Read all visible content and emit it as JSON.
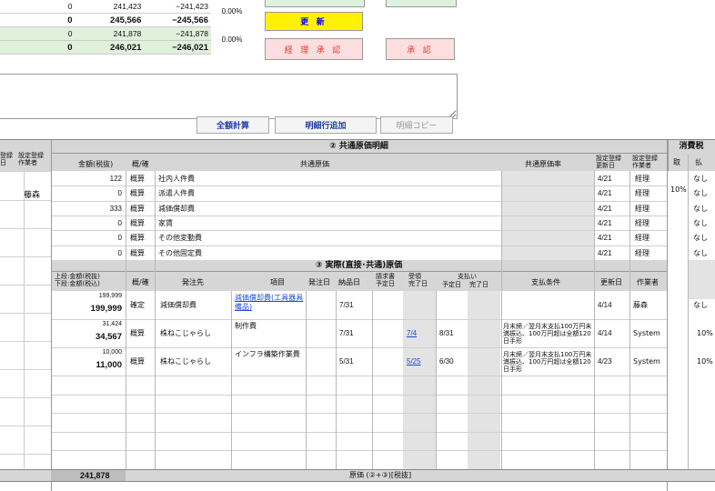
{
  "summary": {
    "rows": [
      {
        "a": "0",
        "b": "241,423",
        "c": "−241,423",
        "style": "plain"
      },
      {
        "a": "0",
        "b": "245,566",
        "c": "−245,566",
        "style": "bold"
      },
      {
        "a": "0",
        "b": "241,878",
        "c": "−241,878",
        "style": "green"
      },
      {
        "a": "0",
        "b": "246,021",
        "c": "−246,021",
        "style": "greenbold"
      }
    ],
    "pct1": "0.00%",
    "pct2": "0.00%"
  },
  "buttons": {
    "update": "更 新",
    "approve_keiri": "経 理 承 認",
    "approve": "承 認",
    "calc_all": "全額計算",
    "add_line": "明細行追加",
    "copy_line": "明細コピー"
  },
  "left_header": {
    "col1": "登録\n日",
    "col2": "設定登録\n作業者"
  },
  "left_row_user": "藤森",
  "shared": {
    "title": "② 共通原価明細",
    "col_amount": "金額(税抜)",
    "col_kind": "概/確",
    "col_name": "共通原価",
    "col_ratio": "共通原価率",
    "col_upd": "設定登録\n更新日",
    "col_user": "設定登録\n作業者",
    "rows": [
      {
        "amount": "122",
        "kind": "概算",
        "name": "社内人件費",
        "date": "4/21",
        "user": "経理"
      },
      {
        "amount": "0",
        "kind": "概算",
        "name": "派遣人件費",
        "date": "4/21",
        "user": "経理"
      },
      {
        "amount": "333",
        "kind": "概算",
        "name": "減価償却費",
        "date": "4/21",
        "user": "経理"
      },
      {
        "amount": "0",
        "kind": "概算",
        "name": "家賃",
        "date": "4/21",
        "user": "経理"
      },
      {
        "amount": "0",
        "kind": "概算",
        "name": "その他変動費",
        "date": "4/21",
        "user": "経理"
      },
      {
        "amount": "0",
        "kind": "概算",
        "name": "その他固定費",
        "date": "4/21",
        "user": "経理"
      }
    ]
  },
  "tax": {
    "title": "消費税",
    "col_take": "取",
    "col_pay": "払",
    "rate": "10%",
    "none": "なし"
  },
  "actual": {
    "title": "③ 実際(直接･共通)原価",
    "col_amount": "上段:金額(税抜)\n下段:金額(税込)",
    "col_kind": "概/確",
    "col_vendor": "発注先",
    "col_item": "項目",
    "col_order": "発注日",
    "col_deliver": "納品日",
    "col_invoice": "請求書\n予定日",
    "col_receipt": "受領\n完了日",
    "col_pay_group": "支払い",
    "col_pay_plan": "予定日",
    "col_pay_done": "完了日",
    "col_terms": "支払条件",
    "col_upd": "更新日",
    "col_user": "作業者",
    "rows": [
      {
        "top": "199,999",
        "bottom": "199,999",
        "kind": "確定",
        "vendor": "減価償却費",
        "item": "減価償却費(工具器具備品)",
        "deliver": "7/31",
        "receipt": "",
        "pay": "",
        "terms": "",
        "upd": "4/14",
        "user": "藤森",
        "tax": "なし"
      },
      {
        "top": "31,424",
        "bottom": "34,567",
        "kind": "概算",
        "vendor": "株ねこじゃらし",
        "item": "制作費",
        "deliver": "7/31",
        "receipt": "7/4",
        "pay": "8/31",
        "terms": "月末締／翌月末支払100万円未満振込、100万円超は全額120日手形",
        "upd": "4/14",
        "user": "System",
        "tax": "10%"
      },
      {
        "top": "10,000",
        "bottom": "11,000",
        "kind": "概算",
        "vendor": "株ねこじゃらし",
        "item": "インフラ構築作業費",
        "deliver": "5/31",
        "receipt": "5/25",
        "pay": "6/30",
        "terms": "月末締／翌月末支払100万円未満振込、100万円超は全額120日手形",
        "upd": "4/23",
        "user": "System",
        "tax": "10%"
      }
    ]
  },
  "footer": {
    "total": "241,878",
    "label": "原価 (②+③)[税抜]"
  }
}
